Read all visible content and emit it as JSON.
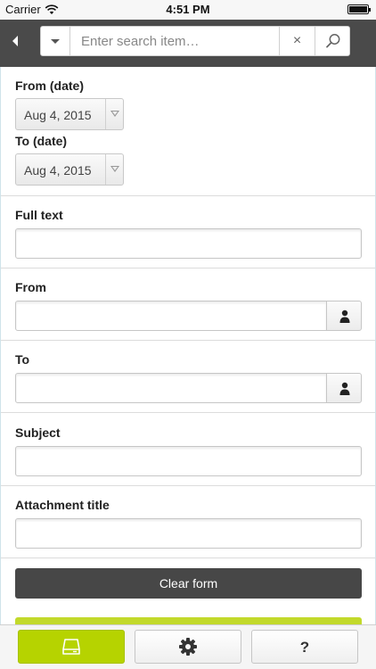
{
  "status_bar": {
    "carrier": "Carrier",
    "time": "4:51 PM"
  },
  "search": {
    "placeholder": "Enter search item…",
    "clear_label": "×"
  },
  "form": {
    "from_date": {
      "label": "From (date)",
      "value": "Aug 4, 2015"
    },
    "to_date": {
      "label": "To (date)",
      "value": "Aug 4, 2015"
    },
    "full_text": {
      "label": "Full text",
      "value": ""
    },
    "from": {
      "label": "From",
      "value": ""
    },
    "to": {
      "label": "To",
      "value": ""
    },
    "subject": {
      "label": "Subject",
      "value": ""
    },
    "attachment_title": {
      "label": "Attachment title",
      "value": ""
    },
    "clear_button": "Clear form"
  },
  "tabbar": {
    "tabs": [
      {
        "icon": "inbox-drive-icon",
        "active": true
      },
      {
        "icon": "gear-icon",
        "active": false
      },
      {
        "icon": "help-icon",
        "label": "?",
        "active": false
      }
    ]
  },
  "colors": {
    "accent": "#b6d300",
    "header": "#4a4a4a",
    "button_dark": "#474747"
  }
}
